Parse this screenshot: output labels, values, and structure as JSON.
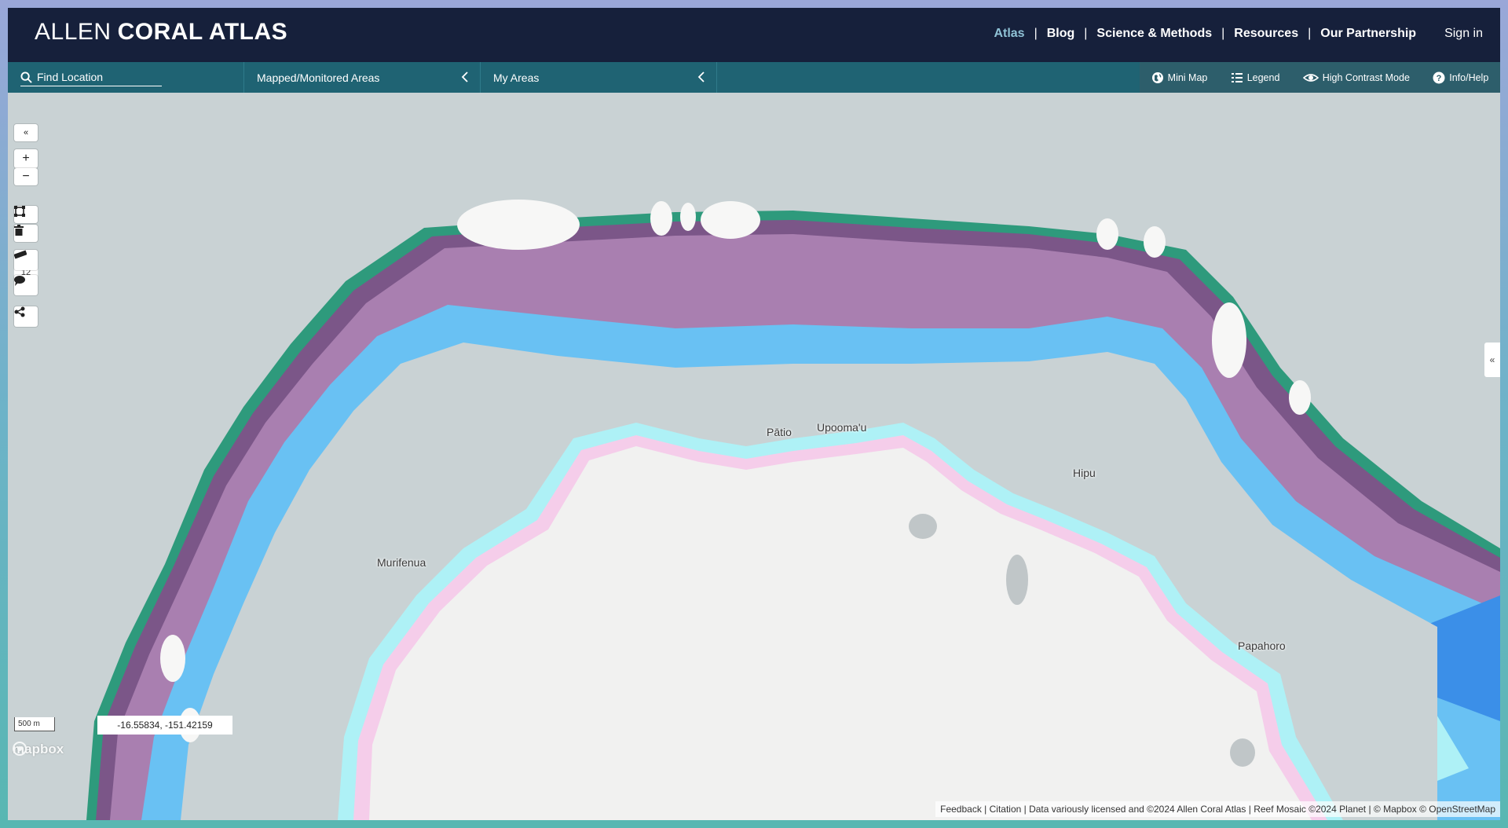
{
  "header": {
    "brand_light": "ALLEN",
    "brand_bold": "CORAL ATLAS",
    "nav": [
      {
        "label": "Atlas",
        "active": true
      },
      {
        "label": "Blog"
      },
      {
        "label": "Science & Methods"
      },
      {
        "label": "Resources"
      },
      {
        "label": "Our Partnership"
      }
    ],
    "sign_in": "Sign in"
  },
  "toolbar": {
    "search_placeholder": "Find Location",
    "mapped_areas": "Mapped/Monitored Areas",
    "my_areas": "My Areas",
    "tools": [
      "Mini Map",
      "Legend",
      "High Contrast Mode",
      "Info/Help"
    ]
  },
  "map": {
    "zoom_level": "12",
    "scale_label": "500 m",
    "coordinates": "-16.55834, -151.42159",
    "places": [
      "Pātio",
      "Upooma'u",
      "Hipu",
      "Murifenua",
      "Papahoro"
    ],
    "attribution": "Feedback | Citation | Data variously licensed and ©2024 Allen Coral Atlas | Reef Mosaic ©2024 Planet | © Mapbox © OpenStreetMap",
    "logo": "mapbox",
    "colors": {
      "water": "#c9d2d4",
      "reef_flat_purple": "#a97fb0",
      "dark_purple": "#7b5688",
      "blue": "#69c1f3",
      "deep_blue": "#3b8fe8",
      "cyan": "#aef1f6",
      "green_slope": "#2e9a7c",
      "island": "#f1f1f0"
    }
  }
}
